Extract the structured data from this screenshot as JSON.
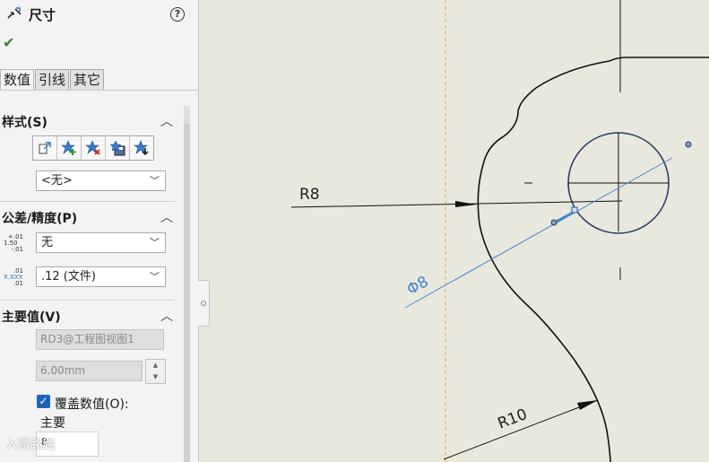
{
  "panel": {
    "title": "尺寸",
    "help": "?",
    "tabs": [
      {
        "label": "数值"
      },
      {
        "label": "引线"
      },
      {
        "label": "其它"
      }
    ],
    "style": {
      "title": "样式(S)",
      "toolbar_icons": [
        "copy-style-icon",
        "add-style-icon",
        "delete-style-icon",
        "save-style-icon",
        "load-style-icon"
      ],
      "selected": "<无>"
    },
    "tolerance": {
      "title": "公差/精度(P)",
      "tolerance_value": "无",
      "precision_value": ".12 (文件)",
      "tol_icon_lines": [
        "+.01",
        "1.50",
        "-.01"
      ],
      "prec_icon_lines": [
        ".01",
        "X.XXX",
        ".01"
      ]
    },
    "primary": {
      "title": "主要值(V)",
      "ref_name": "RD3@工程图视图1",
      "value": "6.00mm",
      "override_label": "覆盖数值(O):",
      "override_checked": true,
      "main_label": "主要",
      "main_value": "8"
    },
    "watermark": "入微路路"
  },
  "drawing": {
    "dim_r8": "R8",
    "dim_dia": "Φ8",
    "dim_r10": "R10",
    "colors": {
      "line": "#111111",
      "selection": "#3f87d6",
      "centerline": "#e3a14a",
      "background": "#e9e8dc"
    }
  }
}
